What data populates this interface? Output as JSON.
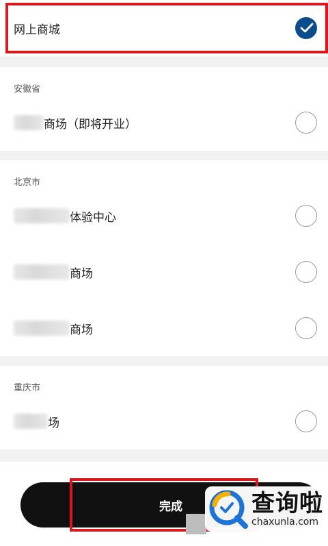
{
  "online": {
    "label": "网上商城",
    "selected": true
  },
  "sections": [
    {
      "title": "安徽省",
      "items": [
        {
          "suffix": "商场（即将开业）",
          "selected": false
        }
      ]
    },
    {
      "title": "北京市",
      "items": [
        {
          "suffix": "体验中心",
          "selected": false
        },
        {
          "suffix": "商场",
          "selected": false
        },
        {
          "suffix": "商场",
          "selected": false
        }
      ]
    },
    {
      "title": "重庆市",
      "items": [
        {
          "suffix": "场",
          "selected": false
        }
      ]
    }
  ],
  "footer": {
    "done_label": "完成"
  },
  "watermark": {
    "cn": "查询啦",
    "en": "chaxunla.com"
  },
  "colors": {
    "accent": "#0b4d8c",
    "highlight": "#d71920",
    "button": "#111111"
  }
}
